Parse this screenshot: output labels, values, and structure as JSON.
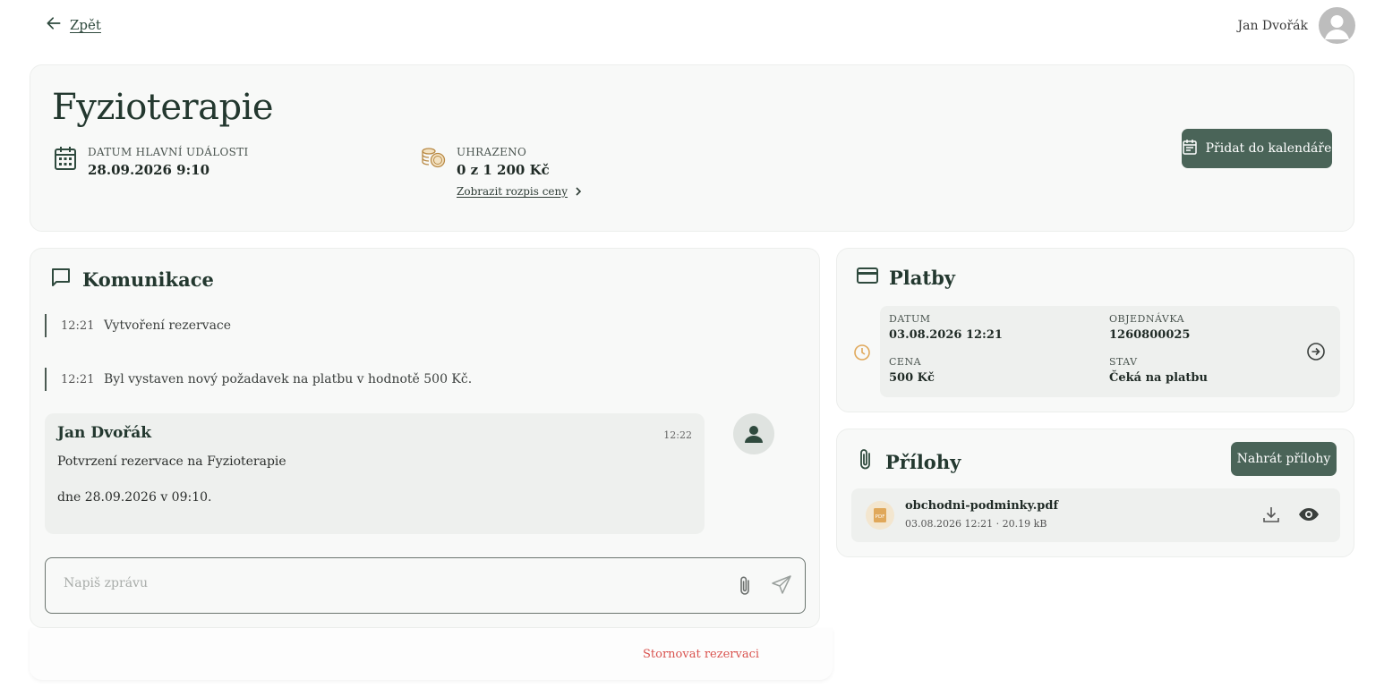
{
  "topbar": {
    "back_label": "Zpět",
    "user_name": "Jan Dvořák"
  },
  "header": {
    "title": "Fyzioterapie",
    "date_caption": "DATUM HLAVNÍ UDÁLOSTI",
    "date_value": "28.09.2026 9:10",
    "paid_caption": "UHRAZENO",
    "paid_value": "0 z 1 200 Kč",
    "price_link": "Zobrazit rozpis ceny",
    "calendar_button": "Přidat do kalendáře"
  },
  "communication": {
    "title": "Komunikace",
    "log": [
      {
        "time": "12:21",
        "text": "Vytvoření rezervace"
      },
      {
        "time": "12:21",
        "text": "Byl vystaven nový požadavek na platbu v hodnotě 500 Kč."
      }
    ],
    "message": {
      "author": "Jan Dvořák",
      "time": "12:22",
      "line1": "Potvrzení rezervace na Fyzioterapie",
      "line2": "dne 28.09.2026 v 09:10."
    },
    "composer_placeholder": "Napiš zprávu",
    "cancel_label": "Stornovat rezervaci"
  },
  "payments": {
    "title": "Platby",
    "item": {
      "date_caption": "DATUM",
      "date_value": "03.08.2026 12:21",
      "order_caption": "OBJEDNÁVKA",
      "order_value": "1260800025",
      "price_caption": "CENA",
      "price_value": "500 Kč",
      "state_caption": "STAV",
      "state_value": "Čeká na platbu"
    }
  },
  "attachments": {
    "title": "Přílohy",
    "upload_button": "Nahrát přílohy",
    "file": {
      "name": "obchodni-podminky.pdf",
      "meta": "03.08.2026 12:21 · 20.19 kB",
      "icon_text": "PDF"
    }
  },
  "colors": {
    "accent": "#4a6458",
    "danger": "#d9534f",
    "pending": "#e0a85a"
  }
}
